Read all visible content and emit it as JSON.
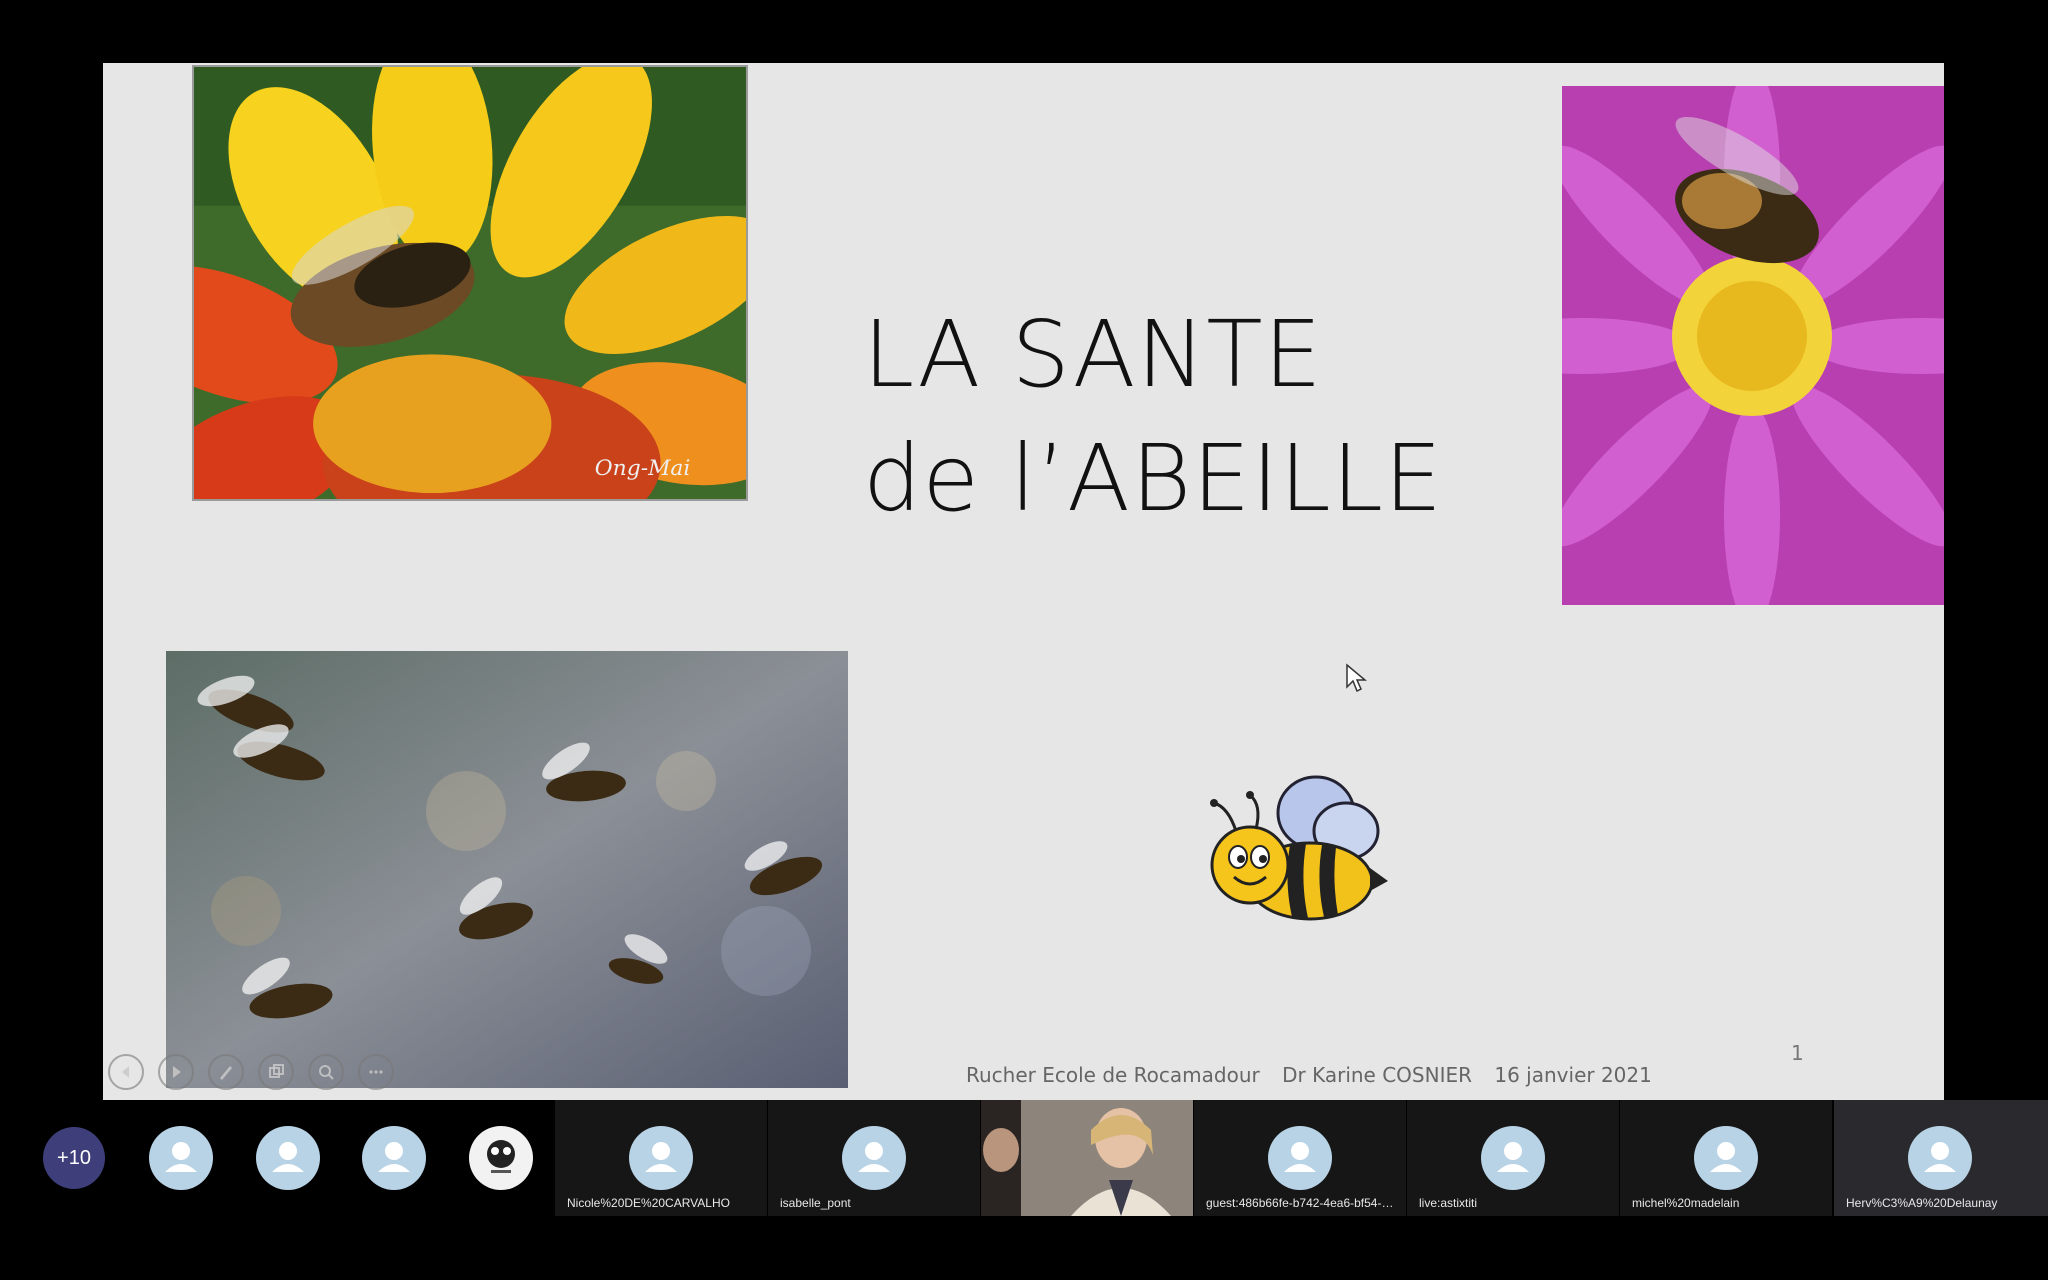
{
  "slide": {
    "title_line1": "LA SANTE",
    "title_line2": "de l’ABEILLE",
    "photo1_signature": "Ong-Mai",
    "footer": {
      "organization": "Rucher Ecole de Rocamadour",
      "author": "Dr Karine COSNIER",
      "date": "16 janvier 2021"
    },
    "page_number": "1",
    "controls": [
      "previous-icon",
      "play-icon",
      "pen-icon",
      "slides-icon",
      "zoom-icon",
      "more-icon"
    ]
  },
  "participants": {
    "more_count": "+10",
    "tiles": [
      {
        "name": "Nicole%20DE%20CARVALHO"
      },
      {
        "name": "isabelle_pont"
      },
      {
        "name": ""
      },
      {
        "name": "guest:486b66fe-b742-4ea6-bf54-e0..."
      },
      {
        "name": "live:astixtiti"
      },
      {
        "name": "michel%20madelain"
      },
      {
        "name": "Herv%C3%A9%20Delaunay"
      }
    ]
  },
  "colors": {
    "slide_bg": "#e6e6e6",
    "strip_bg": "#000000",
    "badge_bg": "#3e3f7a",
    "avatar_bg": "#b8d3e6"
  }
}
